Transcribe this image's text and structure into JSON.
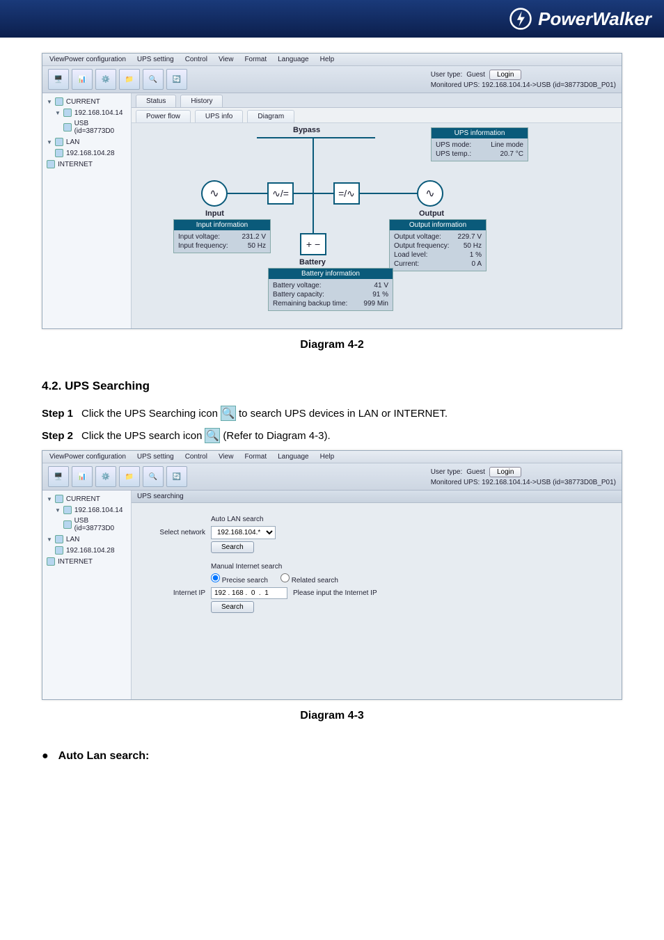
{
  "brand": "PowerWalker",
  "captions": {
    "d42": "Diagram 4-2",
    "d43": "Diagram 4-3"
  },
  "section": "4.2. UPS Searching",
  "step1": {
    "label": "Step 1",
    "before": "Click the UPS Searching icon",
    "after": "to search UPS devices in LAN or INTERNET."
  },
  "step2": {
    "label": "Step 2",
    "before": "Click the UPS search icon",
    "after": "(Refer to Diagram 4-3)."
  },
  "bullet": "Auto Lan search:",
  "menu": [
    "ViewPower configuration",
    "UPS setting",
    "Control",
    "View",
    "Format",
    "Language",
    "Help"
  ],
  "user": {
    "type_label": "User type:",
    "type_value": "Guest",
    "login": "Login",
    "mon_label": "Monitored UPS:",
    "mon_value": "192.168.104.14->USB (id=38773D0B_P01)"
  },
  "nav": {
    "current": "CURRENT",
    "ip1": "192.168.104.14",
    "usb": "USB (id=38773D0",
    "lan": "LAN",
    "ip2": "192.168.104.28",
    "internet": "INTERNET"
  },
  "d42": {
    "tabs1": {
      "status": "Status",
      "history": "History"
    },
    "tabs2": {
      "powerflow": "Power flow",
      "upsinfo": "UPS info",
      "diagram": "Diagram"
    },
    "bypass": "Bypass",
    "input": "Input",
    "output": "Output",
    "battery": "Battery",
    "ups_info": {
      "title": "UPS information",
      "mode_l": "UPS mode:",
      "mode_v": "Line mode",
      "temp_l": "UPS temp.:",
      "temp_v": "20.7 °C"
    },
    "input_info": {
      "title": "Input information",
      "volt_l": "Input voltage:",
      "volt_v": "231.2 V",
      "freq_l": "Input frequency:",
      "freq_v": "50 Hz"
    },
    "output_info": {
      "title": "Output information",
      "volt_l": "Output voltage:",
      "volt_v": "229.7 V",
      "freq_l": "Output frequency:",
      "freq_v": "50 Hz",
      "load_l": "Load level:",
      "load_v": "1 %",
      "curr_l": "Current:",
      "curr_v": "0 A"
    },
    "battery_info": {
      "title": "Battery information",
      "volt_l": "Battery voltage:",
      "volt_v": "41 V",
      "cap_l": "Battery capacity:",
      "cap_v": "91 %",
      "rem_l": "Remaining backup time:",
      "rem_v": "999 Min"
    }
  },
  "d43": {
    "panel_title": "UPS searching",
    "auto_lan": "Auto LAN search",
    "select_network": "Select network",
    "network_value": "192.168.104.*",
    "search": "Search",
    "manual": "Manual Internet search",
    "precise": "Precise search",
    "related": "Related search",
    "internet_ip": "Internet IP",
    "ip_value": "192 . 168 .  0  .  1",
    "ip_hint": "Please input the Internet IP"
  }
}
